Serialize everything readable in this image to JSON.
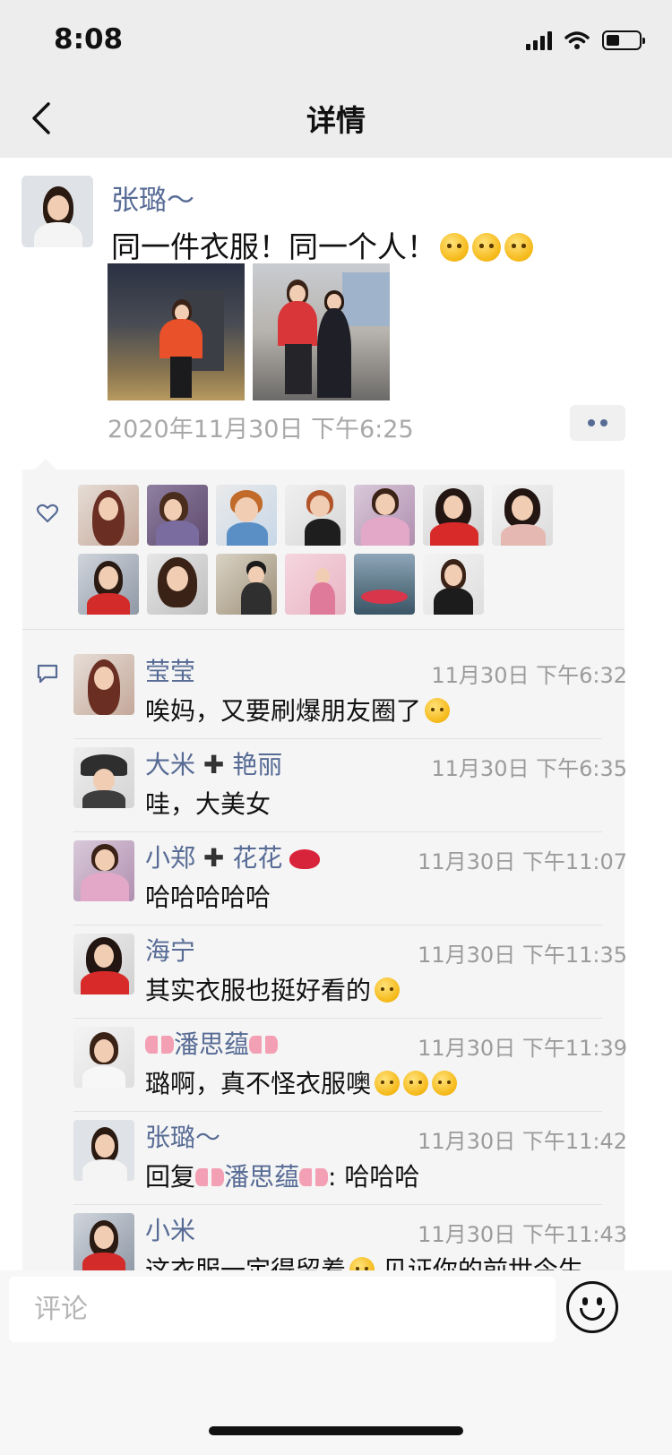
{
  "status_bar": {
    "time": "8:08",
    "battery_level": 0.4
  },
  "nav": {
    "title": "详情",
    "back_icon": "chevron-left-icon"
  },
  "post": {
    "author": "张璐～",
    "text": "同一件衣服！同一个人！",
    "text_emoji": "thinking-emoji",
    "timestamp": "2020年11月30日 下午6:25",
    "more_icon": "more-dots-icon",
    "photo_count": 2
  },
  "likes": {
    "icon": "heart-outline-icon",
    "count": 13
  },
  "comments": {
    "icon": "comment-bubble-icon",
    "items": [
      {
        "name": "莹莹",
        "time": "11月30日 下午6:32",
        "text": "唉妈，又要刷爆朋友圈了"
      },
      {
        "name": "大米",
        "name2": "艳丽",
        "time": "11月30日 下午6:35",
        "text": "哇，大美女"
      },
      {
        "name": "小郑",
        "name2": "花花",
        "time": "11月30日 下午11:07",
        "text": "哈哈哈哈哈"
      },
      {
        "name": "海宁",
        "time": "11月30日 下午11:35",
        "text": "其实衣服也挺好看的"
      },
      {
        "name": "潘思蕴",
        "time": "11月30日 下午11:39",
        "text": "璐啊，真不怪衣服噢"
      },
      {
        "name": "张璐～",
        "time": "11月30日 下午11:42",
        "reply_prefix": "回复",
        "reply_to": "潘思蕴",
        "text": ": 哈哈哈"
      },
      {
        "name": "小米",
        "time": "11月30日 下午11:43",
        "text": "这衣服一定得留着",
        "text2": "见证你的前世今生"
      }
    ]
  },
  "input": {
    "placeholder": "评论",
    "emoji_button_icon": "smiley-icon"
  }
}
